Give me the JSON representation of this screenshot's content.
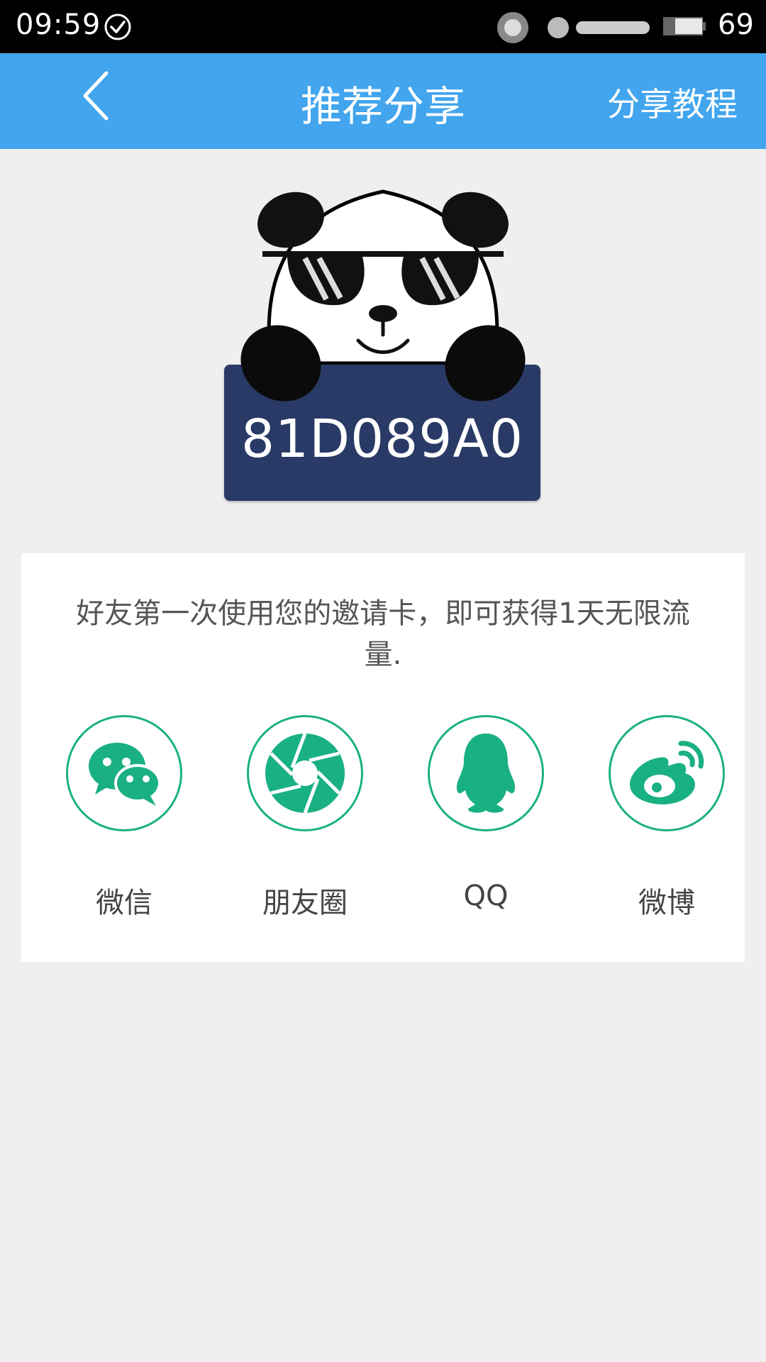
{
  "status_bar": {
    "time": "09:59",
    "battery_level": "69"
  },
  "app_bar": {
    "title": "推荐分享",
    "tutorial_link": "分享教程"
  },
  "invite": {
    "code": "81D089A0"
  },
  "panel": {
    "description": "好友第一次使用您的邀请卡，即可获得1天无限流量.",
    "share_options": [
      {
        "label": "微信",
        "icon": "wechat-icon"
      },
      {
        "label": "朋友圈",
        "icon": "moments-icon"
      },
      {
        "label": "QQ",
        "icon": "qq-icon"
      },
      {
        "label": "微博",
        "icon": "weibo-icon"
      }
    ]
  },
  "colors": {
    "app_bar": "#42a5ee",
    "share_accent": "#19b083",
    "code_card": "#2a3a66"
  }
}
